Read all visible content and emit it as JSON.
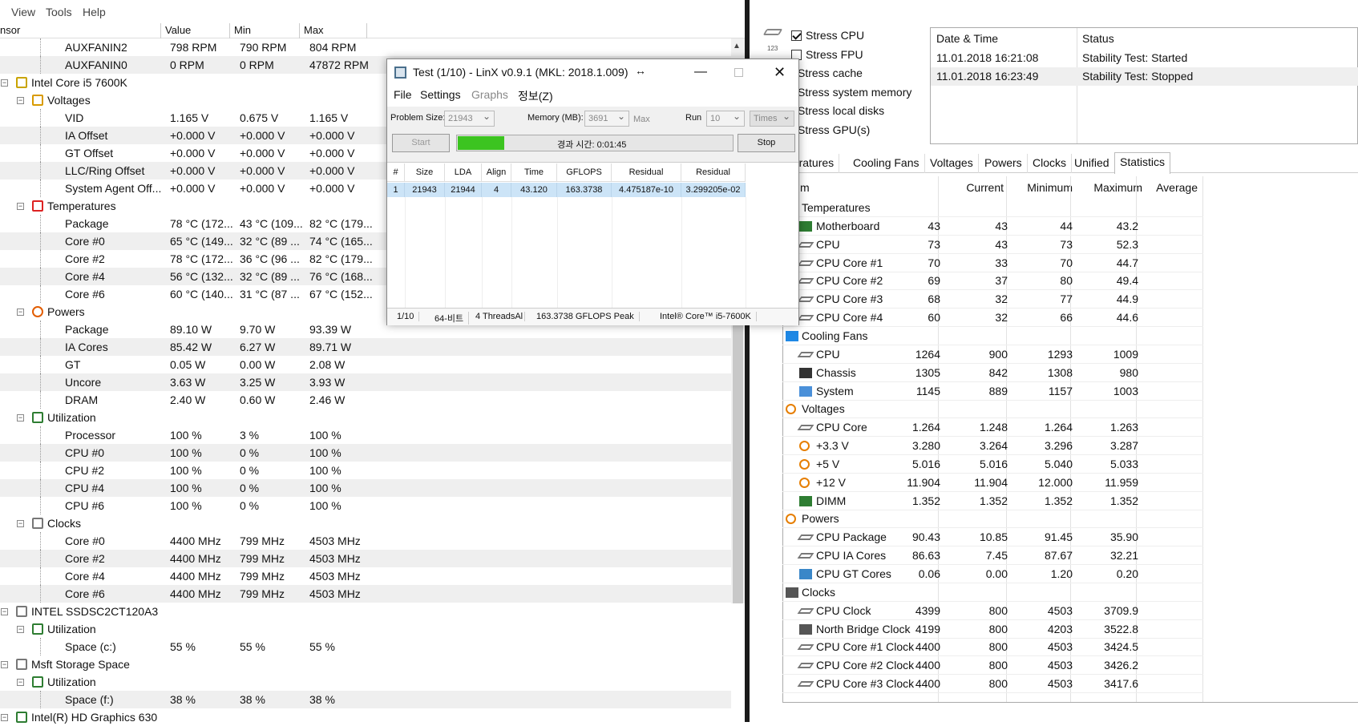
{
  "left_window": {
    "menu": [
      "View",
      "Tools",
      "Help"
    ],
    "columns": [
      "nsor",
      "Value",
      "Min",
      "Max"
    ],
    "rows": [
      {
        "indent": 3,
        "label": "AUXFANIN2",
        "value": "798 RPM",
        "min": "790 RPM",
        "max": "804 RPM"
      },
      {
        "indent": 3,
        "label": "AUXFANIN0",
        "value": "0 RPM",
        "min": "0 RPM",
        "max": "47872 RPM"
      },
      {
        "indent": 1,
        "label": "Intel Core i5 7600K",
        "value": "",
        "min": "",
        "max": "",
        "icon": "cpu-chip-icon"
      },
      {
        "indent": 2,
        "label": "Voltages",
        "value": "",
        "min": "",
        "max": "",
        "icon": "voltage-icon"
      },
      {
        "indent": 3,
        "label": "VID",
        "value": "1.165 V",
        "min": "0.675 V",
        "max": "1.165 V"
      },
      {
        "indent": 3,
        "label": "IA Offset",
        "value": "+0.000 V",
        "min": "+0.000 V",
        "max": "+0.000 V"
      },
      {
        "indent": 3,
        "label": "GT Offset",
        "value": "+0.000 V",
        "min": "+0.000 V",
        "max": "+0.000 V"
      },
      {
        "indent": 3,
        "label": "LLC/Ring Offset",
        "value": "+0.000 V",
        "min": "+0.000 V",
        "max": "+0.000 V"
      },
      {
        "indent": 3,
        "label": "System Agent Off...",
        "value": "+0.000 V",
        "min": "+0.000 V",
        "max": "+0.000 V"
      },
      {
        "indent": 2,
        "label": "Temperatures",
        "value": "",
        "min": "",
        "max": "",
        "icon": "thermometer-icon"
      },
      {
        "indent": 3,
        "label": "Package",
        "value": "78 °C  (172...",
        "min": "43 °C  (109...",
        "max": "82 °C  (179..."
      },
      {
        "indent": 3,
        "label": "Core #0",
        "value": "65 °C  (149...",
        "min": "32 °C  (89 ...",
        "max": "74 °C  (165..."
      },
      {
        "indent": 3,
        "label": "Core #2",
        "value": "78 °C  (172...",
        "min": "36 °C  (96 ...",
        "max": "82 °C  (179..."
      },
      {
        "indent": 3,
        "label": "Core #4",
        "value": "56 °C  (132...",
        "min": "32 °C  (89 ...",
        "max": "76 °C  (168..."
      },
      {
        "indent": 3,
        "label": "Core #6",
        "value": "60 °C  (140...",
        "min": "31 °C  (87 ...",
        "max": "67 °C  (152..."
      },
      {
        "indent": 2,
        "label": "Powers",
        "value": "",
        "min": "",
        "max": "",
        "icon": "power-icon"
      },
      {
        "indent": 3,
        "label": "Package",
        "value": "89.10 W",
        "min": "9.70 W",
        "max": "93.39 W"
      },
      {
        "indent": 3,
        "label": "IA Cores",
        "value": "85.42 W",
        "min": "6.27 W",
        "max": "89.71 W"
      },
      {
        "indent": 3,
        "label": "GT",
        "value": "0.05 W",
        "min": "0.00 W",
        "max": "2.08 W"
      },
      {
        "indent": 3,
        "label": "Uncore",
        "value": "3.63 W",
        "min": "3.25 W",
        "max": "3.93 W"
      },
      {
        "indent": 3,
        "label": "DRAM",
        "value": "2.40 W",
        "min": "0.60 W",
        "max": "2.46 W"
      },
      {
        "indent": 2,
        "label": "Utilization",
        "value": "",
        "min": "",
        "max": "",
        "icon": "utilization-icon"
      },
      {
        "indent": 3,
        "label": "Processor",
        "value": "100 %",
        "min": "3 %",
        "max": "100 %"
      },
      {
        "indent": 3,
        "label": "CPU #0",
        "value": "100 %",
        "min": "0 %",
        "max": "100 %"
      },
      {
        "indent": 3,
        "label": "CPU #2",
        "value": "100 %",
        "min": "0 %",
        "max": "100 %"
      },
      {
        "indent": 3,
        "label": "CPU #4",
        "value": "100 %",
        "min": "0 %",
        "max": "100 %"
      },
      {
        "indent": 3,
        "label": "CPU #6",
        "value": "100 %",
        "min": "0 %",
        "max": "100 %"
      },
      {
        "indent": 2,
        "label": "Clocks",
        "value": "",
        "min": "",
        "max": "",
        "icon": "clock-icon"
      },
      {
        "indent": 3,
        "label": "Core #0",
        "value": "4400 MHz",
        "min": "799 MHz",
        "max": "4503 MHz"
      },
      {
        "indent": 3,
        "label": "Core #2",
        "value": "4400 MHz",
        "min": "799 MHz",
        "max": "4503 MHz"
      },
      {
        "indent": 3,
        "label": "Core #4",
        "value": "4400 MHz",
        "min": "799 MHz",
        "max": "4503 MHz"
      },
      {
        "indent": 3,
        "label": "Core #6",
        "value": "4400 MHz",
        "min": "799 MHz",
        "max": "4503 MHz"
      },
      {
        "indent": 1,
        "label": "INTEL SSDSC2CT120A3",
        "value": "",
        "min": "",
        "max": "",
        "icon": "disk-icon"
      },
      {
        "indent": 2,
        "label": "Utilization",
        "value": "",
        "min": "",
        "max": "",
        "icon": "utilization-icon"
      },
      {
        "indent": 3,
        "label": "Space (c:)",
        "value": "55 %",
        "min": "55 %",
        "max": "55 %"
      },
      {
        "indent": 1,
        "label": "Msft Storage Space",
        "value": "",
        "min": "",
        "max": "",
        "icon": "disk-icon"
      },
      {
        "indent": 2,
        "label": "Utilization",
        "value": "",
        "min": "",
        "max": "",
        "icon": "utilization-icon"
      },
      {
        "indent": 3,
        "label": "Space (f:)",
        "value": "38 %",
        "min": "38 %",
        "max": "38 %"
      },
      {
        "indent": 1,
        "label": "Intel(R) HD Graphics 630",
        "value": "",
        "min": "",
        "max": "",
        "icon": "gpu-icon"
      }
    ]
  },
  "linx": {
    "title": "Test (1/10) - LinX v0.9.1 (MKL: 2018.1.009)",
    "menu": [
      "File",
      "Settings",
      "Graphs",
      "정보(Z)"
    ],
    "problem_size_label": "Problem Size:",
    "problem_size": "21943",
    "memory_label": "Memory (MB):",
    "memory": "3691",
    "max_label": "Max",
    "run_label": "Run",
    "run": "10",
    "times": "Times",
    "start_label": "Start",
    "stop_label": "Stop",
    "elapsed": "경과 시간: 0:01:45",
    "progress_fraction": 0.17,
    "columns": [
      "#",
      "Size",
      "LDA",
      "Align",
      "Time",
      "GFLOPS",
      "Residual",
      "Residual (norm.)"
    ],
    "row": [
      "1",
      "21943",
      "21944",
      "4",
      "43.120",
      "163.3738",
      "4.475187e-10",
      "3.299205e-02"
    ],
    "status": [
      "1/10",
      "64-비트",
      "4 ThreadsAl",
      "163.3738 GFLOPS Peak",
      "Intel® Core™ i5-7600K"
    ]
  },
  "stress": {
    "options": [
      {
        "label": "Stress CPU",
        "checked": true
      },
      {
        "label": "Stress FPU",
        "checked": false
      },
      {
        "label": "Stress cache",
        "checked": false
      },
      {
        "label": "Stress system memory",
        "checked": false
      },
      {
        "label": "Stress local disks",
        "checked": false
      },
      {
        "label": "Stress GPU(s)",
        "checked": false
      }
    ],
    "log_headers": [
      "Date & Time",
      "Status"
    ],
    "log": [
      {
        "time": "11.01.2018 16:21:08",
        "status": "Stability Test: Started"
      },
      {
        "time": "11.01.2018 16:23:49",
        "status": "Stability Test: Stopped"
      }
    ]
  },
  "stats": {
    "tabs": [
      "peratures",
      "Cooling Fans",
      "Voltages",
      "Powers",
      "Clocks",
      "Unified",
      "Statistics"
    ],
    "active_tab": "Statistics",
    "headers": [
      "m",
      "Current",
      "Minimum",
      "Maximum",
      "Average"
    ],
    "rows": [
      {
        "group": true,
        "label": "Temperatures",
        "icon": "thermometer-icon"
      },
      {
        "label": "Motherboard",
        "icon": "motherboard-icon",
        "cur": "43",
        "min": "43",
        "max": "44",
        "avg": "43.2"
      },
      {
        "label": "CPU",
        "icon": "cpu-icon",
        "cur": "73",
        "min": "43",
        "max": "73",
        "avg": "52.3"
      },
      {
        "label": "CPU Core #1",
        "icon": "cpu-icon",
        "cur": "70",
        "min": "33",
        "max": "70",
        "avg": "44.7"
      },
      {
        "label": "CPU Core #2",
        "icon": "cpu-icon",
        "cur": "69",
        "min": "37",
        "max": "80",
        "avg": "49.4"
      },
      {
        "label": "CPU Core #3",
        "icon": "cpu-icon",
        "cur": "68",
        "min": "32",
        "max": "77",
        "avg": "44.9"
      },
      {
        "label": "CPU Core #4",
        "icon": "cpu-icon",
        "cur": "60",
        "min": "32",
        "max": "66",
        "avg": "44.6"
      },
      {
        "group": true,
        "label": "Cooling Fans",
        "icon": "fan-icon"
      },
      {
        "label": "CPU",
        "icon": "cpu-icon",
        "cur": "1264",
        "min": "900",
        "max": "1293",
        "avg": "1009"
      },
      {
        "label": "Chassis",
        "icon": "chassis-icon",
        "cur": "1305",
        "min": "842",
        "max": "1308",
        "avg": "980"
      },
      {
        "label": "System",
        "icon": "system-icon",
        "cur": "1145",
        "min": "889",
        "max": "1157",
        "avg": "1003"
      },
      {
        "group": true,
        "label": "Voltages",
        "icon": "voltage-icon"
      },
      {
        "label": "CPU Core",
        "icon": "cpu-icon",
        "cur": "1.264",
        "min": "1.248",
        "max": "1.264",
        "avg": "1.263"
      },
      {
        "label": "+3.3 V",
        "icon": "voltage-icon",
        "cur": "3.280",
        "min": "3.264",
        "max": "3.296",
        "avg": "3.287"
      },
      {
        "label": "+5 V",
        "icon": "voltage-icon",
        "cur": "5.016",
        "min": "5.016",
        "max": "5.040",
        "avg": "5.033"
      },
      {
        "label": "+12 V",
        "icon": "voltage-icon",
        "cur": "11.904",
        "min": "11.904",
        "max": "12.000",
        "avg": "11.959"
      },
      {
        "label": "DIMM",
        "icon": "dimm-icon",
        "cur": "1.352",
        "min": "1.352",
        "max": "1.352",
        "avg": "1.352"
      },
      {
        "group": true,
        "label": "Powers",
        "icon": "power-icon"
      },
      {
        "label": "CPU Package",
        "icon": "cpu-icon",
        "cur": "90.43",
        "min": "10.85",
        "max": "91.45",
        "avg": "35.90"
      },
      {
        "label": "CPU IA Cores",
        "icon": "cpu-icon",
        "cur": "86.63",
        "min": "7.45",
        "max": "87.67",
        "avg": "32.21"
      },
      {
        "label": "CPU GT Cores",
        "icon": "gpu-icon",
        "cur": "0.06",
        "min": "0.00",
        "max": "1.20",
        "avg": "0.20"
      },
      {
        "group": true,
        "label": "Clocks",
        "icon": "clock-icon"
      },
      {
        "label": "CPU Clock",
        "icon": "cpu-icon",
        "cur": "4399",
        "min": "800",
        "max": "4503",
        "avg": "3709.9"
      },
      {
        "label": "North Bridge Clock",
        "icon": "northbridge-icon",
        "cur": "4199",
        "min": "800",
        "max": "4203",
        "avg": "3522.8"
      },
      {
        "label": "CPU Core #1 Clock",
        "icon": "cpu-icon",
        "cur": "4400",
        "min": "800",
        "max": "4503",
        "avg": "3424.5"
      },
      {
        "label": "CPU Core #2 Clock",
        "icon": "cpu-icon",
        "cur": "4400",
        "min": "800",
        "max": "4503",
        "avg": "3426.2"
      },
      {
        "label": "CPU Core #3 Clock",
        "icon": "cpu-icon",
        "cur": "4400",
        "min": "800",
        "max": "4503",
        "avg": "3417.6"
      }
    ]
  },
  "colors": {
    "progress": "#3cc420",
    "selection": "#cce4f7",
    "row_alt": "#efefef"
  }
}
